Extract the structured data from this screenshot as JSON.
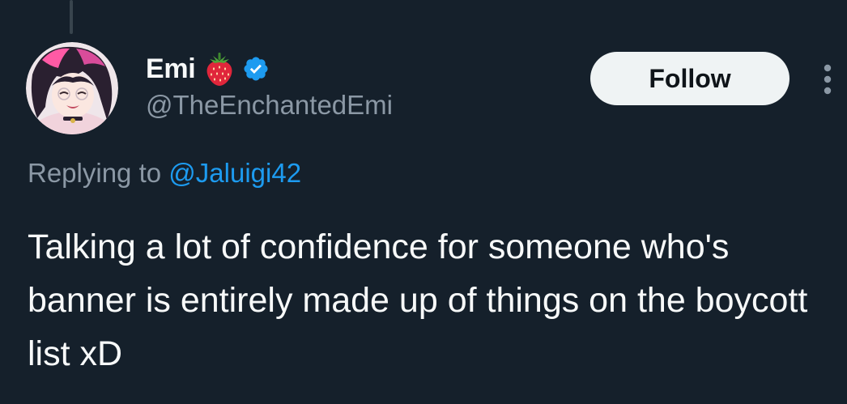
{
  "tweet": {
    "author": {
      "display_name": "Emi",
      "name_emoji": "strawberry-emoji",
      "verified": true,
      "handle": "@TheEnchantedEmi"
    },
    "follow_label": "Follow",
    "reply_prefix": "Replying to",
    "reply_to": "@Jaluigi42",
    "text": "Talking a lot of confidence for someone who's banner is entirely made up of things on the boycott list xD"
  },
  "icons": {
    "verified": "verified-badge-icon",
    "more": "more-options-icon"
  },
  "colors": {
    "background": "#15202b",
    "text_primary": "#f7f9f9",
    "text_secondary": "#8b98a5",
    "accent": "#1d9bf0",
    "button_bg": "#eff3f4"
  }
}
